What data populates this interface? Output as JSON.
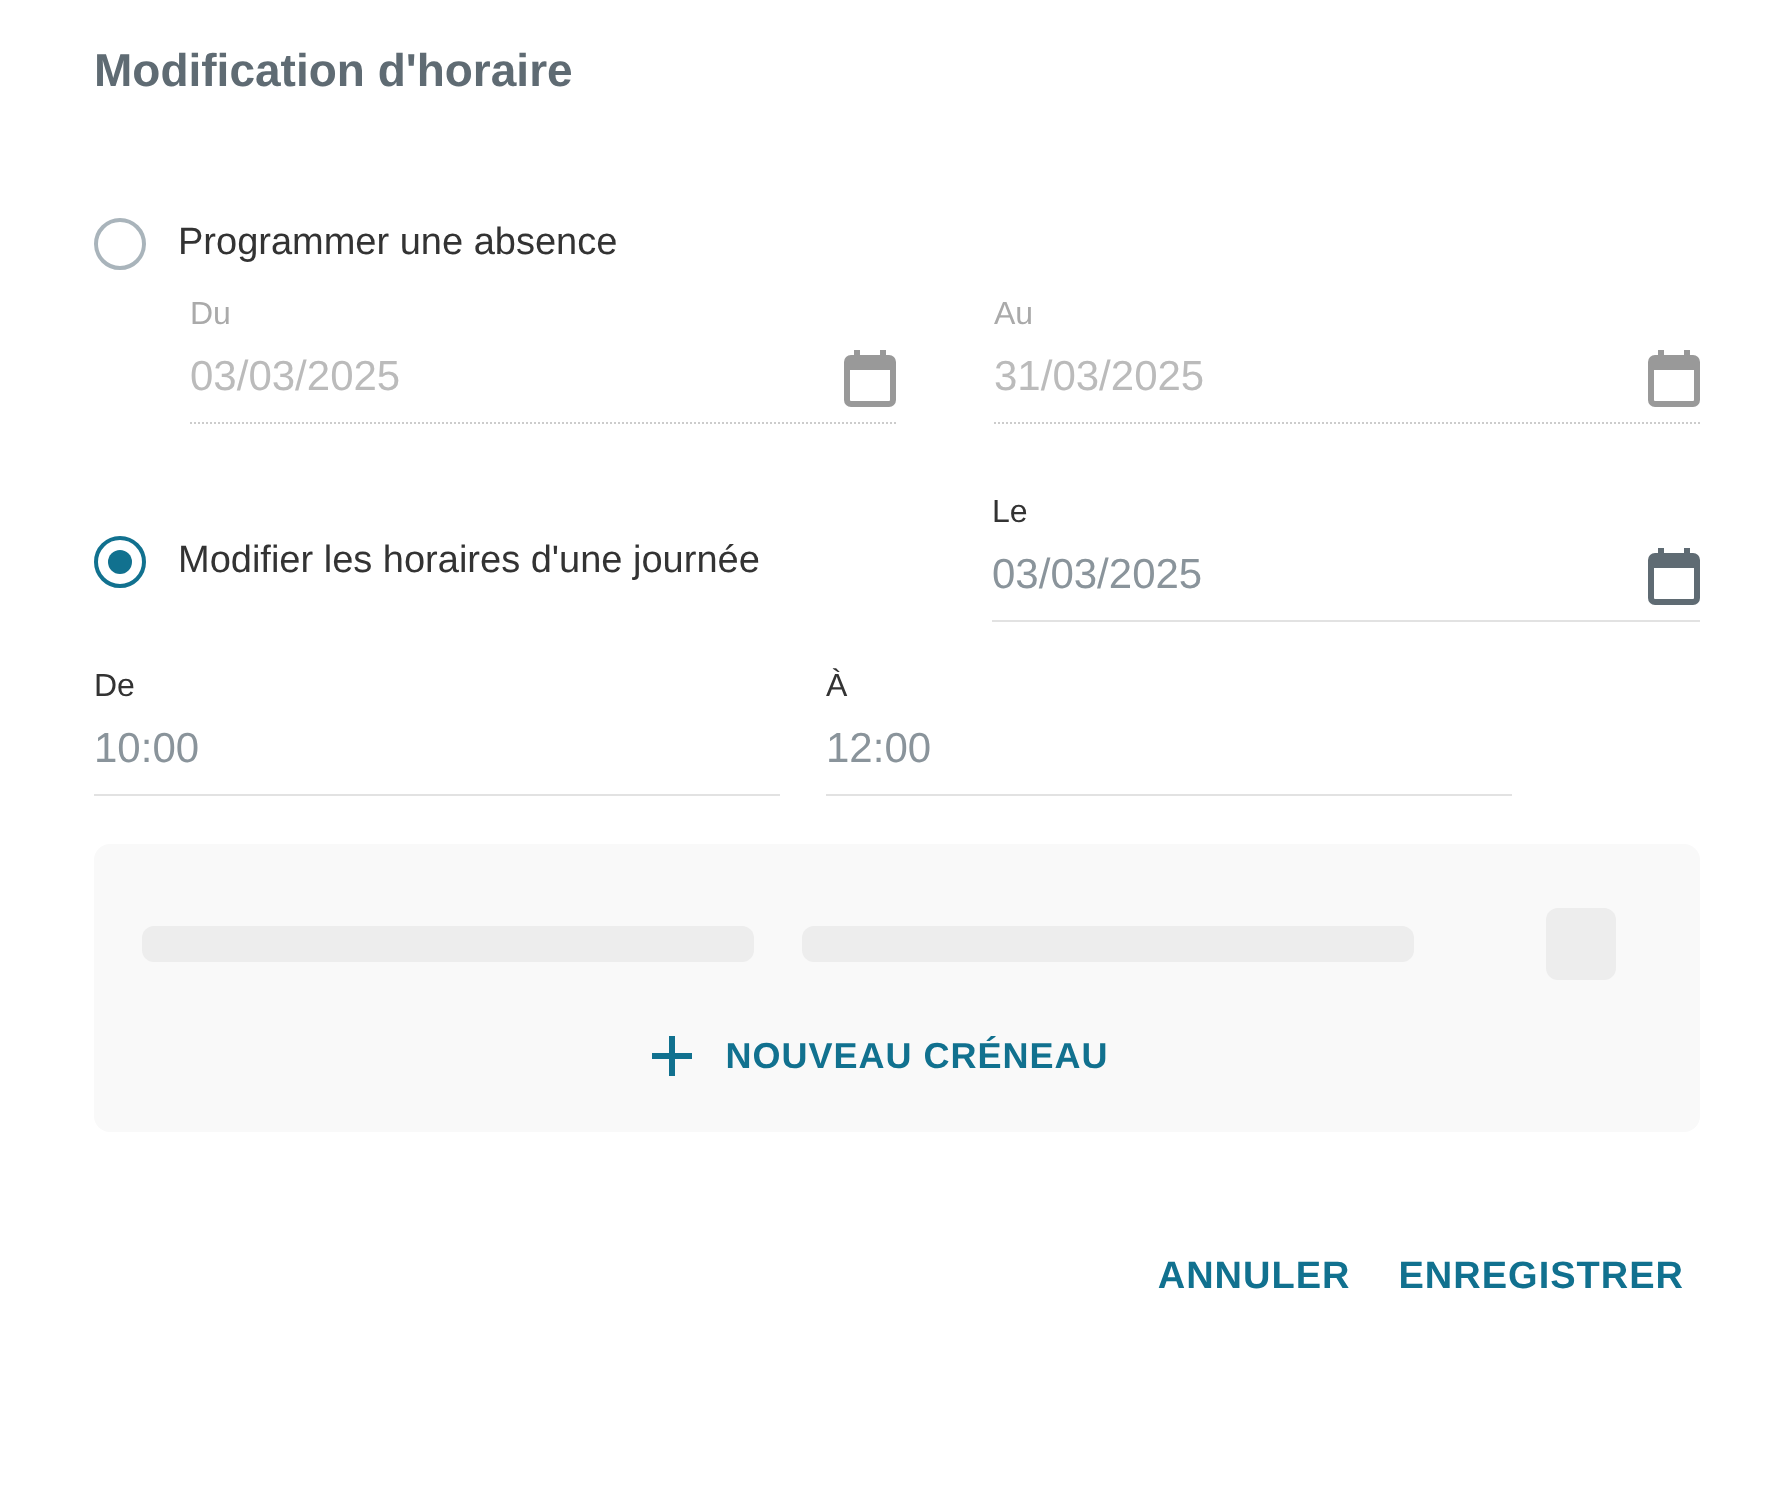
{
  "dialog": {
    "title": "Modification d'horaire"
  },
  "options": [
    {
      "label": "Programmer une absence",
      "selected": false,
      "fields": [
        {
          "label": "Du",
          "value": "03/03/2025",
          "disabled": true
        },
        {
          "label": "Au",
          "value": "31/03/2025",
          "disabled": true
        }
      ]
    },
    {
      "label": "Modifier les horaires d'une journée",
      "selected": true,
      "fields": [
        {
          "label": "Le",
          "value": "03/03/2025",
          "disabled": false
        }
      ]
    }
  ],
  "time_fields": [
    {
      "label": "De",
      "value": "10:00"
    },
    {
      "label": "À",
      "value": "12:00"
    }
  ],
  "slots": {
    "add_button": "NOUVEAU CRÉNEAU"
  },
  "buttons": [
    "ANNULER",
    "ENREGISTRER"
  ]
}
